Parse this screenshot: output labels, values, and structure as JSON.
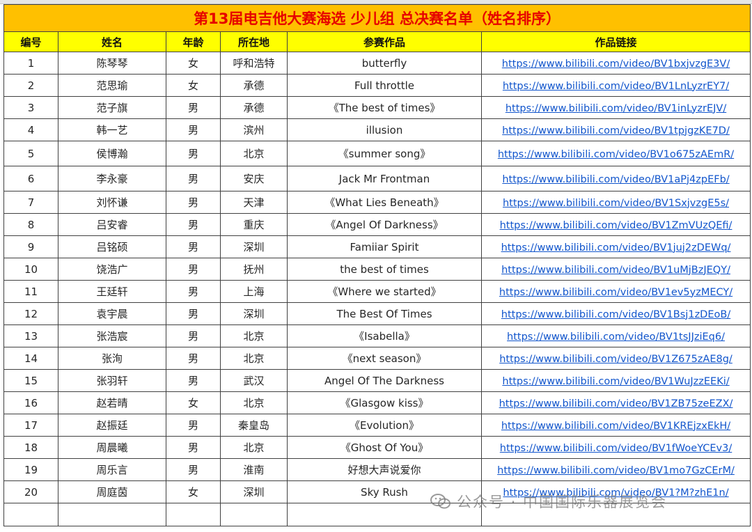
{
  "title": "第13届电吉他大赛海选 少儿组 总决赛名单（姓名排序）",
  "headers": [
    "编号",
    "姓名",
    "年龄",
    "所在地",
    "参赛作品",
    "作品链接"
  ],
  "rows": [
    {
      "no": "1",
      "name": "陈琴琴",
      "age": "女",
      "city": "呼和浩特",
      "work": "butterfly",
      "link": "https://www.bilibili.com/video/BV1bxjvzgE3V/"
    },
    {
      "no": "2",
      "name": "范思瑜",
      "age": "女",
      "city": "承德",
      "work": "Full throttle",
      "link": "https://www.bilibili.com/video/BV1LnLyzrEY7/"
    },
    {
      "no": "3",
      "name": "范子旗",
      "age": "男",
      "city": "承德",
      "work": "《The best of times》",
      "link": "https://www.bilibili.com/video/BV1inLyzrEJV/"
    },
    {
      "no": "4",
      "name": "韩一艺",
      "age": "男",
      "city": "滨州",
      "work": "illusion",
      "link": "https://www.bilibili.com/video/BV1tpjgzKE7D/"
    },
    {
      "no": "5",
      "name": "侯博瀚",
      "age": "男",
      "city": "北京",
      "work": "《summer song》",
      "link": "https://www.bilibili.com/video/BV1o675zAEmR/"
    },
    {
      "no": "6",
      "name": "李永豪",
      "age": "男",
      "city": "安庆",
      "work": "Jack Mr Frontman",
      "link": "https://www.bilibili.com/video/BV1aPj4zpEFb/"
    },
    {
      "no": "7",
      "name": "刘怀谦",
      "age": "男",
      "city": "天津",
      "work": "《What Lies Beneath》",
      "link": "https://www.bilibili.com/video/BV1SxjvzgE5s/"
    },
    {
      "no": "8",
      "name": "吕安睿",
      "age": "男",
      "city": "重庆",
      "work": "《Angel Of Darkness》",
      "link": "https://www.bilibili.com/video/BV1ZmVUzQEfi/"
    },
    {
      "no": "9",
      "name": "吕铭硕",
      "age": "男",
      "city": "深圳",
      "work": "Famiiar Spirit",
      "link": "https://www.bilibili.com/video/BV1juj2zDEWq/"
    },
    {
      "no": "10",
      "name": "饶浩广",
      "age": "男",
      "city": "抚州",
      "work": "the best of times",
      "link": "https://www.bilibili.com/video/BV1uMjBzJEQY/"
    },
    {
      "no": "11",
      "name": "王廷轩",
      "age": "男",
      "city": "上海",
      "work": "《Where we started》",
      "link": "https://www.bilibili.com/video/BV1ev5yzMECY/"
    },
    {
      "no": "12",
      "name": "袁宇晨",
      "age": "男",
      "city": "深圳",
      "work": "The Best Of Times",
      "link": "https://www.bilibili.com/video/BV1Bsj1zDEoB/"
    },
    {
      "no": "13",
      "name": "张浩宸",
      "age": "男",
      "city": "北京",
      "work": "《Isabella》",
      "link": "https://www.bilibili.com/video/BV1tsJJziEq6/"
    },
    {
      "no": "14",
      "name": "张洵",
      "age": "男",
      "city": "北京",
      "work": "《next season》",
      "link": "https://www.bilibili.com/video/BV1Z675zAE8g/"
    },
    {
      "no": "15",
      "name": "张羽轩",
      "age": "男",
      "city": "武汉",
      "work": "Angel Of The Darkness",
      "link": "https://www.bilibili.com/video/BV1WuJzzEEKi/"
    },
    {
      "no": "16",
      "name": "赵若晴",
      "age": "女",
      "city": "北京",
      "work": "《Glasgow kiss》",
      "link": "https://www.bilibili.com/video/BV1ZB75zeEZX/"
    },
    {
      "no": "17",
      "name": "赵振廷",
      "age": "男",
      "city": "秦皇岛",
      "work": "《Evolution》",
      "link": "https://www.bilibili.com/video/BV1KREjzxEkH/"
    },
    {
      "no": "18",
      "name": "周晨曦",
      "age": "男",
      "city": "北京",
      "work": "《Ghost Of You》",
      "link": "https://www.bilibili.com/video/BV1fWoeYCEv3/"
    },
    {
      "no": "19",
      "name": "周乐言",
      "age": "男",
      "city": "淮南",
      "work": "好想大声说爱你",
      "link": "https://www.bilibili.com/video/BV1mo7GzCErM/"
    },
    {
      "no": "20",
      "name": "周庭茵",
      "age": "女",
      "city": "深圳",
      "work": "Sky Rush",
      "link": "https://www.bilibili.com/video/BV1?M?zhE1n/"
    }
  ],
  "watermark": "公众号 · 中国国际乐器展览会",
  "colors": {
    "title_bg": "#ffc000",
    "title_text": "#e60000",
    "header_bg": "#ffff00",
    "link": "#1155cc"
  }
}
